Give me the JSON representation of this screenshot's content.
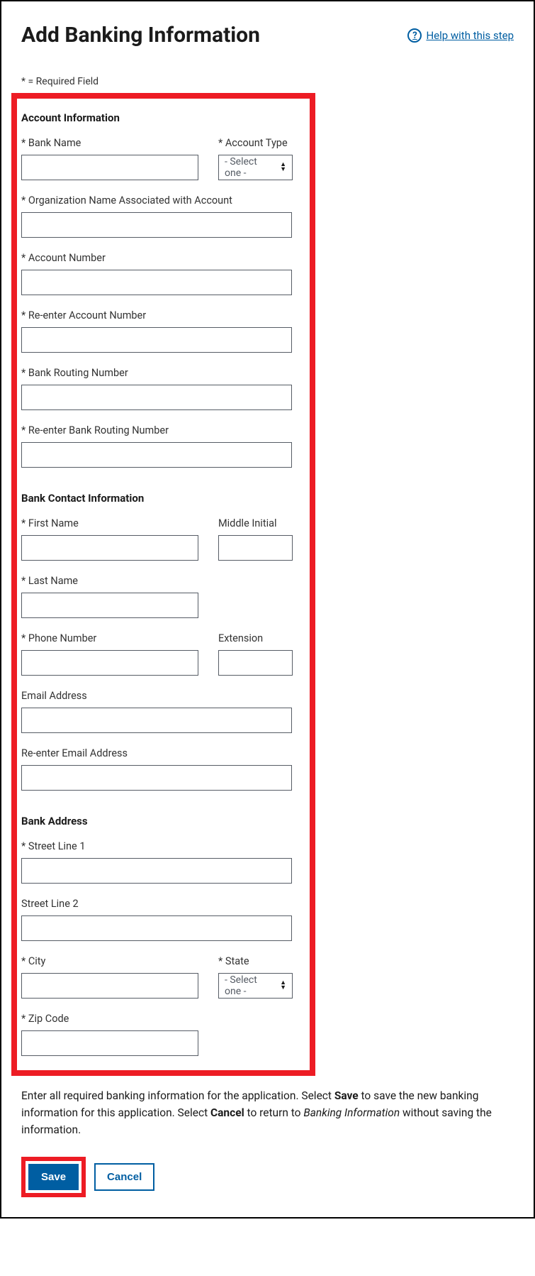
{
  "header": {
    "title": "Add Banking Information",
    "help_label": " Help with this step",
    "help_icon_char": "?"
  },
  "required_note": "* = Required Field",
  "sections": {
    "account": {
      "heading": "Account Information",
      "bank_name": "* Bank Name",
      "account_type": "* Account Type",
      "account_type_placeholder": "- Select one -",
      "org_name": "* Organization Name Associated with Account",
      "account_number": "* Account Number",
      "re_account_number": "* Re-enter Account Number",
      "routing": "* Bank Routing Number",
      "re_routing": "* Re-enter Bank Routing Number"
    },
    "contact": {
      "heading": "Bank Contact Information",
      "first_name": "* First Name",
      "middle_initial": "Middle Initial",
      "last_name": "* Last Name",
      "phone": "* Phone Number",
      "extension": "Extension",
      "email": "Email Address",
      "re_email": "Re-enter Email Address"
    },
    "address": {
      "heading": "Bank Address",
      "street1": "* Street Line 1",
      "street2": "Street Line 2",
      "city": "* City",
      "state": "* State",
      "state_placeholder": "- Select one -",
      "zip": "* Zip Code"
    }
  },
  "instructions": {
    "p1a": "Enter all required banking information for the application. Select ",
    "p1b_strong": "Save",
    "p1c": " to save the new banking information for this application. Select ",
    "p1d_strong": "Cancel",
    "p1e": " to return to ",
    "p1f_em": "Banking Information",
    "p1g": " without saving the information."
  },
  "buttons": {
    "save": "Save",
    "cancel": "Cancel"
  }
}
